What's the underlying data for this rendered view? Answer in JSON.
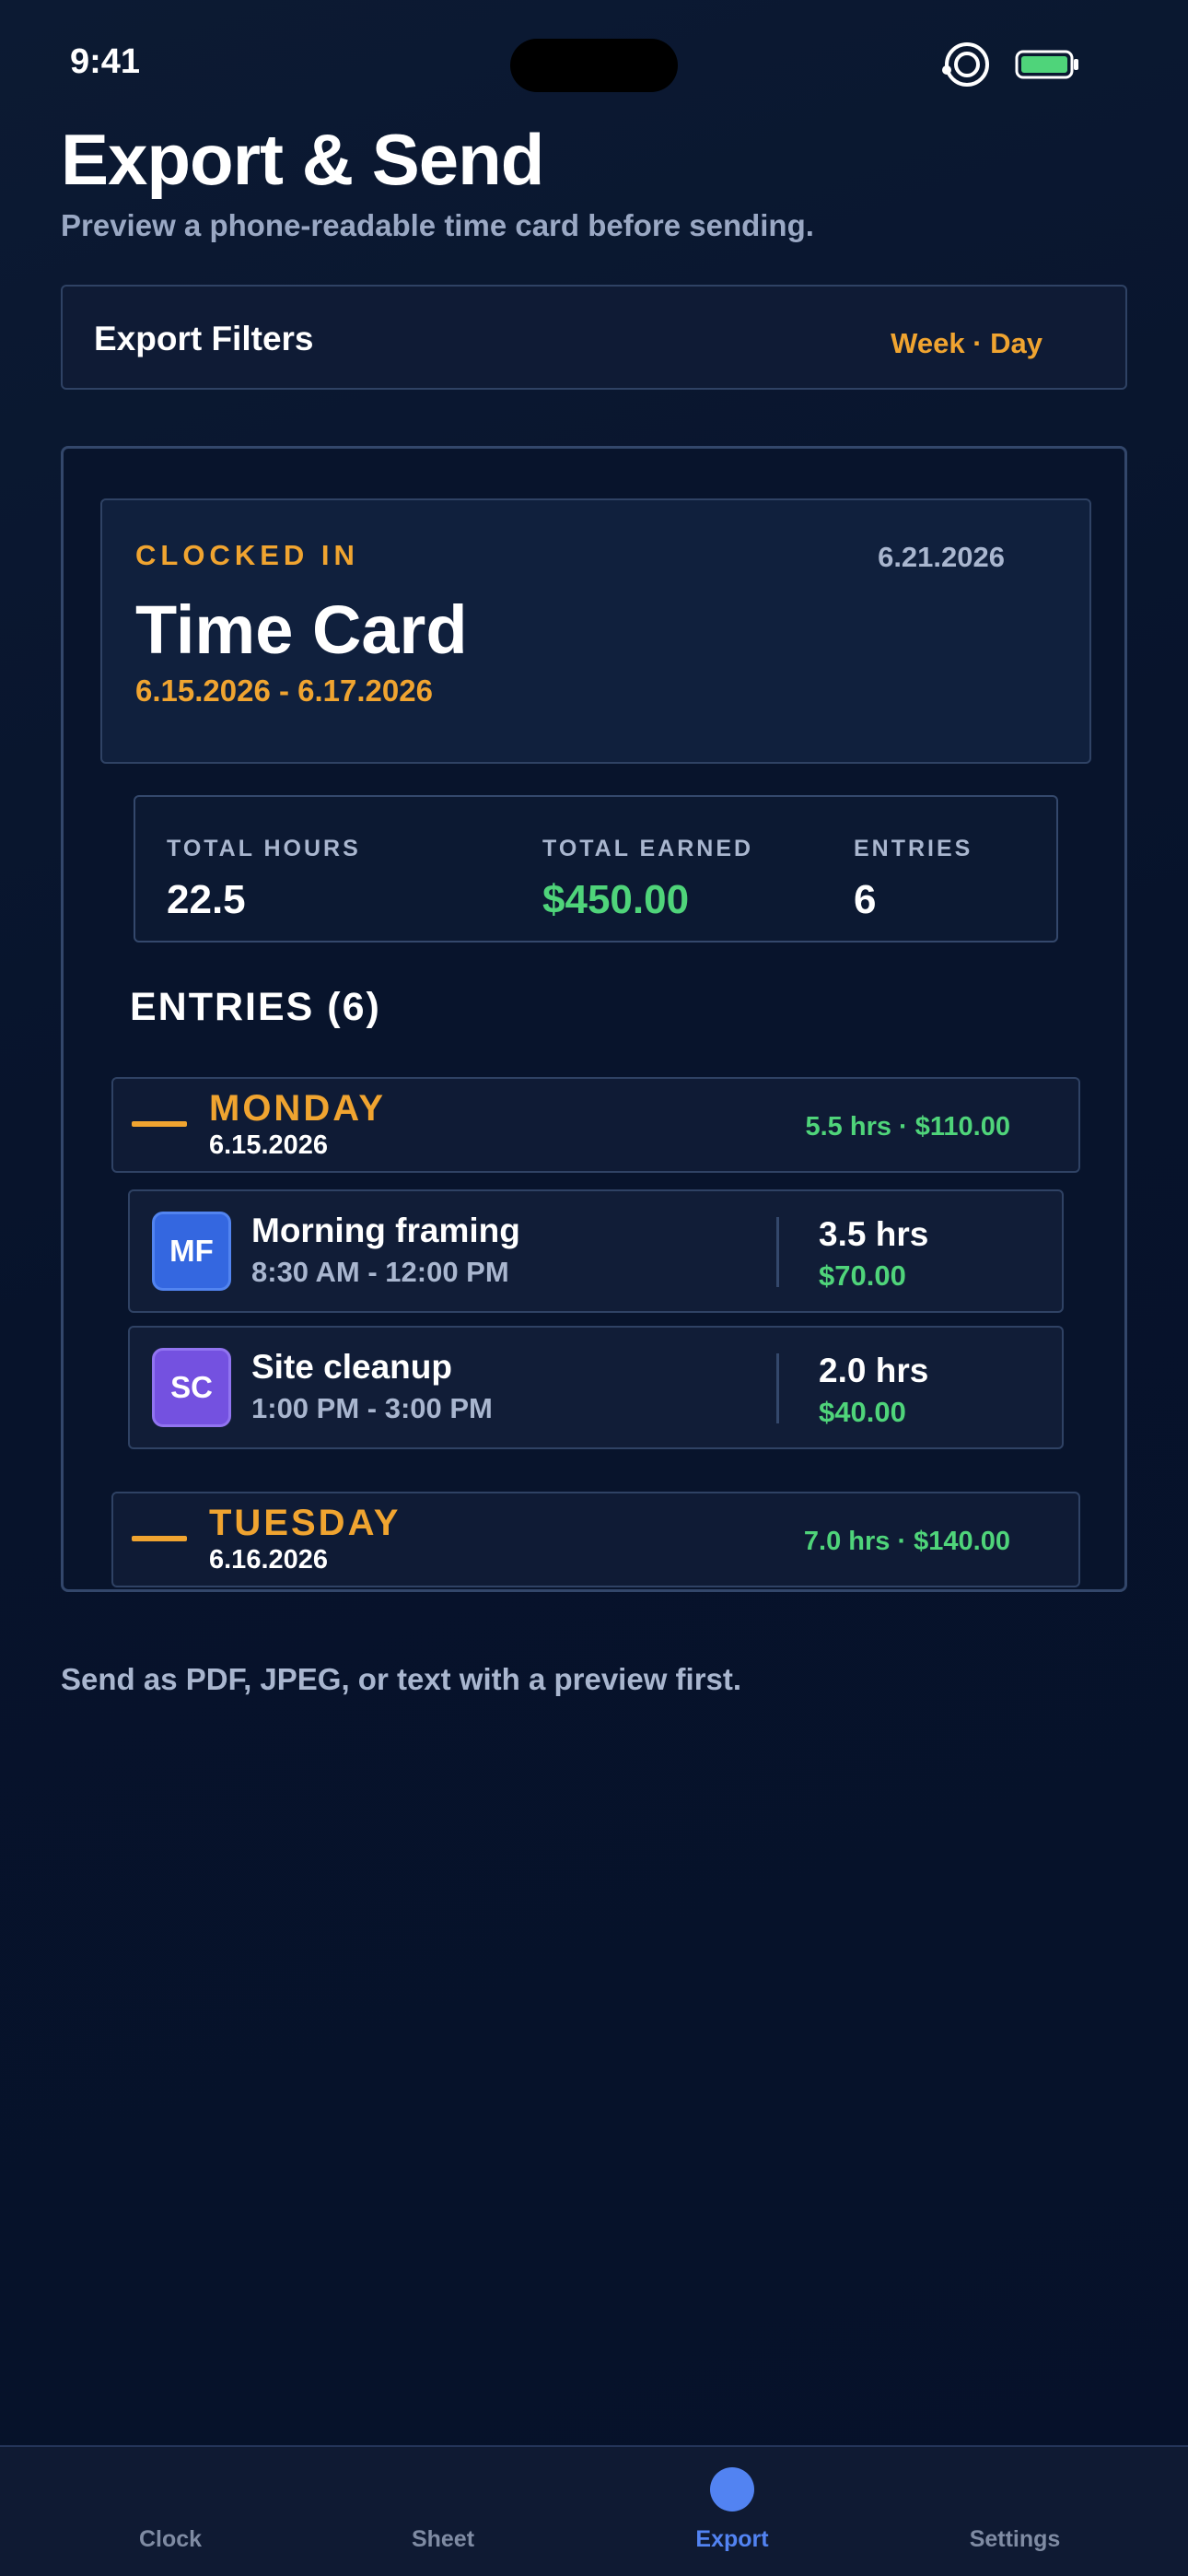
{
  "status_bar": {
    "time": "9:41"
  },
  "header": {
    "title": "Export & Send",
    "subtitle": "Preview a phone-readable time card before sending."
  },
  "filters": {
    "title": "Export Filters",
    "value": "Week · Day"
  },
  "time_card": {
    "status": "CLOCKED IN",
    "date": "6.21.2026",
    "title": "Time Card",
    "range": "6.15.2026 - 6.17.2026",
    "totals": [
      {
        "label": "TOTAL HOURS",
        "value": "22.5"
      },
      {
        "label": "TOTAL EARNED",
        "value": "$450.00"
      },
      {
        "label": "ENTRIES",
        "value": "6"
      }
    ],
    "entries_heading": "ENTRIES (6)",
    "days": [
      {
        "name": "MONDAY",
        "date": "6.15.2026",
        "summary": "5.5 hrs · $110.00",
        "entries": [
          {
            "initials": "MF",
            "name": "Morning framing",
            "time": "8:30 AM - 12:00 PM",
            "hours": "3.5 hrs",
            "earned": "$70.00",
            "color": "#3467e0"
          },
          {
            "initials": "SC",
            "name": "Site cleanup",
            "time": "1:00 PM - 3:00 PM",
            "hours": "2.0 hrs",
            "earned": "$40.00",
            "color": "#7451e0"
          }
        ]
      },
      {
        "name": "TUESDAY",
        "date": "6.16.2026",
        "summary": "7.0 hrs · $140.00",
        "entries": []
      }
    ]
  },
  "footer_note": "Send as PDF, JPEG, or text with a preview first.",
  "tabs": [
    {
      "label": "Clock",
      "active": false
    },
    {
      "label": "Sheet",
      "active": false
    },
    {
      "label": "Export",
      "active": true
    },
    {
      "label": "Settings",
      "active": false
    }
  ],
  "colors": {
    "accent": "#f0a430",
    "positive": "#4fd47a",
    "active_tab": "#5283f2",
    "background": "#08132a"
  }
}
